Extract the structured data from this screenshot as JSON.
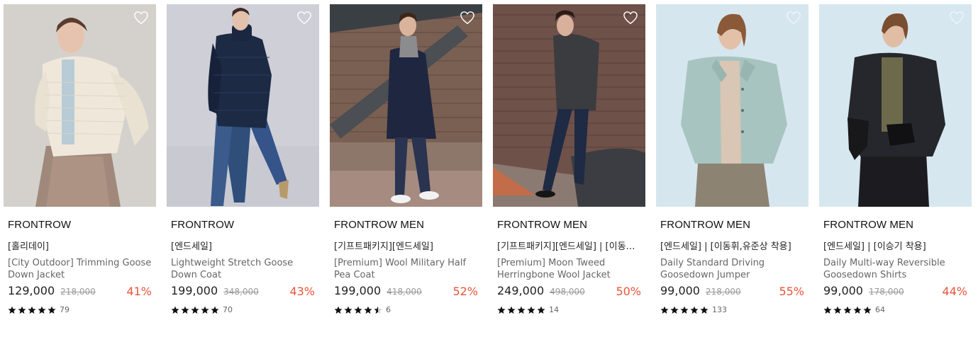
{
  "colors": {
    "discount": "#e8553a",
    "star": "#111111",
    "strike": "#999999"
  },
  "products": [
    {
      "image": "woman-cream-quilted-down-jacket",
      "brand": "FRONTROW",
      "tags": "[홀리데이]",
      "name": "[City Outdoor] Trimming Goose Down Jacket",
      "price": "129,000",
      "original_price": "218,000",
      "discount": "41%",
      "rating": 5,
      "reviews": "79"
    },
    {
      "image": "woman-navy-long-puffer-coat",
      "brand": "FRONTROW",
      "tags": "[엔드세일]",
      "name": "Lightweight Stretch Goose Down Coat",
      "price": "199,000",
      "original_price": "348,000",
      "discount": "43%",
      "rating": 5,
      "reviews": "70"
    },
    {
      "image": "man-navy-pea-coat-stairs",
      "brand": "FRONTROW MEN",
      "tags": "[기프트패키지][엔드세일]",
      "name": "[Premium] Wool Military Half Pea Coat",
      "price": "199,000",
      "original_price": "418,000",
      "discount": "52%",
      "rating": 4.5,
      "reviews": "6"
    },
    {
      "image": "man-grey-tweed-jacket-brick-wall",
      "brand": "FRONTROW MEN",
      "tags": "[기프트패키지][엔드세일] | [이동…",
      "name": "[Premium] Moon Tweed Herringbone Wool Jacket",
      "price": "249,000",
      "original_price": "498,000",
      "discount": "50%",
      "rating": 5,
      "reviews": "14"
    },
    {
      "image": "man-mint-driving-jumper",
      "brand": "FRONTROW MEN",
      "tags": "[엔드세일] | [이동휘,유준상 착용]",
      "name": "Daily Standard Driving Goosedown Jumper",
      "price": "99,000",
      "original_price": "218,000",
      "discount": "55%",
      "rating": 5,
      "reviews": "133"
    },
    {
      "image": "man-black-down-shirt-jacket",
      "brand": "FRONTROW MEN",
      "tags": "[엔드세일] | [이승기 착용]",
      "name": "Daily Multi-way Reversible Goosedown Shirts",
      "price": "99,000",
      "original_price": "178,000",
      "discount": "44%",
      "rating": 5,
      "reviews": "64"
    }
  ]
}
